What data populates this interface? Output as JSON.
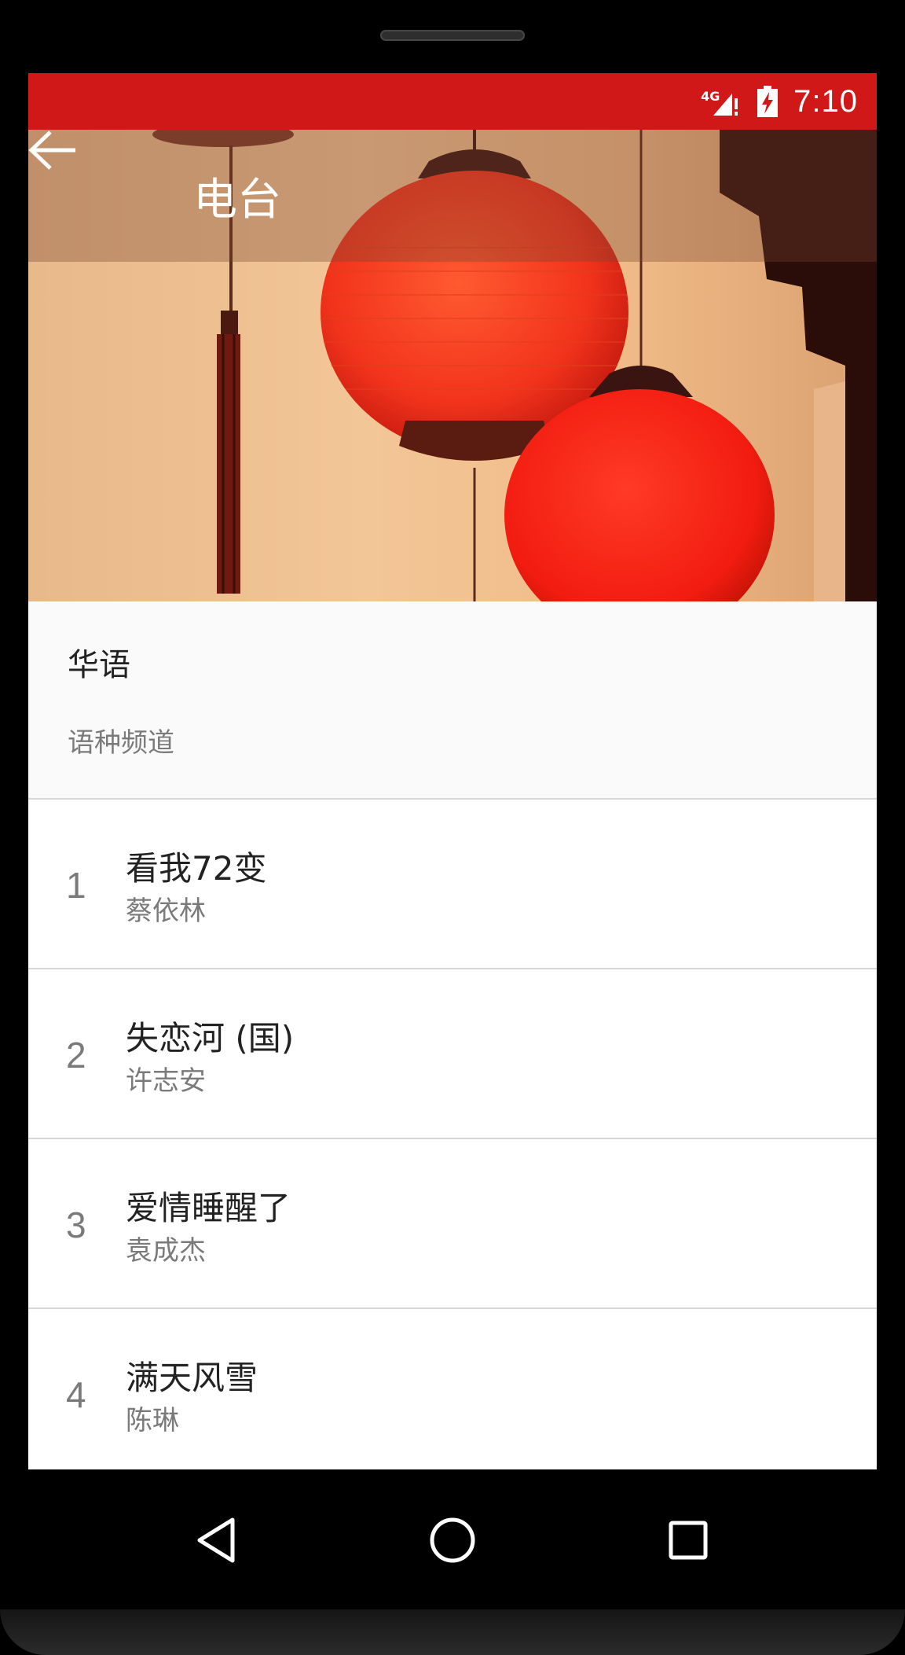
{
  "status_bar": {
    "network": "4G",
    "time": "7:10",
    "signal_icon": "signal-icon",
    "battery_icon": "battery-charging-icon",
    "bar_color": "#d01818"
  },
  "app_bar": {
    "title": "电台",
    "back_icon": "arrow-back-icon"
  },
  "channel": {
    "name": "华语",
    "type": "语种频道"
  },
  "songs": [
    {
      "index": "1",
      "title": "看我72变",
      "artist": "蔡依林"
    },
    {
      "index": "2",
      "title": "失恋河 (国)",
      "artist": "许志安"
    },
    {
      "index": "3",
      "title": "爱情睡醒了",
      "artist": "袁成杰"
    },
    {
      "index": "4",
      "title": "满天风雪",
      "artist": "陈琳"
    }
  ],
  "nav_bar": {
    "back_icon": "nav-back-icon",
    "home_icon": "nav-home-icon",
    "recents_icon": "nav-recents-icon"
  }
}
